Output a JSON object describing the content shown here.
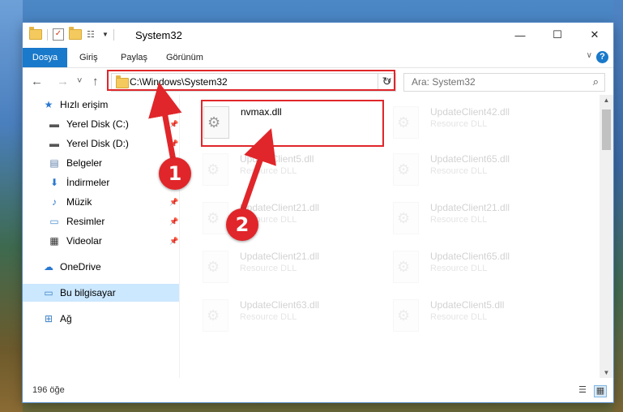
{
  "window": {
    "title": "System32",
    "controls": {
      "minimize": "—",
      "maximize": "☐",
      "close": "✕"
    }
  },
  "ribbon": {
    "tabs": [
      "Dosya",
      "Giriş",
      "Paylaş",
      "Görünüm"
    ],
    "help": "?"
  },
  "navigation": {
    "back": "←",
    "forward": "→",
    "recent": "˅",
    "up": "↑",
    "address": "C:\\Windows\\System32",
    "search_placeholder": "Ara: System32"
  },
  "sidebar": {
    "items": [
      {
        "label": "Hızlı erişim",
        "icon": "star-icon"
      },
      {
        "label": "Yerel Disk (C:)",
        "icon": "drive-icon",
        "pinned": true
      },
      {
        "label": "Yerel Disk (D:)",
        "icon": "drive-icon",
        "pinned": true
      },
      {
        "label": "Belgeler",
        "icon": "documents-icon",
        "pinned": true
      },
      {
        "label": "İndirmeler",
        "icon": "download-icon",
        "pinned": true
      },
      {
        "label": "Müzik",
        "icon": "music-icon",
        "pinned": true
      },
      {
        "label": "Resimler",
        "icon": "pictures-icon",
        "pinned": true
      },
      {
        "label": "Videolar",
        "icon": "videos-icon",
        "pinned": true
      },
      {
        "label": "OneDrive",
        "icon": "cloud-icon"
      },
      {
        "label": "Bu bilgisayar",
        "icon": "computer-icon",
        "selected": true
      },
      {
        "label": "Ağ",
        "icon": "network-icon"
      }
    ]
  },
  "files": [
    {
      "name": "nvmax.dll",
      "type": "",
      "highlighted": true
    },
    {
      "name": "UpdateClient42.dll",
      "type": "Resource DLL"
    },
    {
      "name": "UpdateClient5.dll",
      "type": "Resource DLL"
    },
    {
      "name": "UpdateClient65.dll",
      "type": "Resource DLL"
    },
    {
      "name": "UpdateClient21.dll",
      "type": "Resource DLL"
    },
    {
      "name": "UpdateClient21.dll",
      "type": "Resource DLL"
    },
    {
      "name": "UpdateClient21.dll",
      "type": "Resource DLL"
    },
    {
      "name": "UpdateClient65.dll",
      "type": "Resource DLL"
    },
    {
      "name": "UpdateClient63.dll",
      "type": "Resource DLL"
    },
    {
      "name": "UpdateClient5.dll",
      "type": "Resource DLL"
    }
  ],
  "status": {
    "item_count": "196 öğe"
  },
  "annotations": {
    "step1": "1",
    "step2": "2"
  },
  "colors": {
    "accent": "#1979ca",
    "highlight": "#e0262a",
    "selected_bg": "#cce8ff"
  }
}
